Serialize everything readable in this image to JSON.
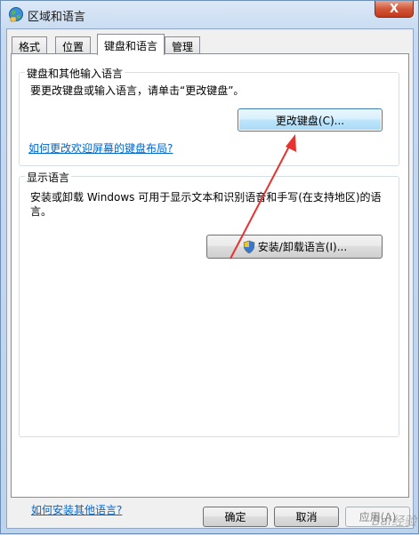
{
  "window": {
    "title": "区域和语言",
    "close_glyph": "X"
  },
  "tabs": [
    {
      "label": "格式"
    },
    {
      "label": "位置"
    },
    {
      "label": "键盘和语言"
    },
    {
      "label": "管理"
    }
  ],
  "keyboard_group": {
    "legend": "键盘和其他输入语言",
    "description": "要更改键盘或输入语言，请单击“更改键盘”。",
    "change_button": "更改键盘(C)...",
    "welcome_link": "如何更改欢迎屏幕的键盘布局?"
  },
  "display_group": {
    "legend": "显示语言",
    "description_line1": "安装或卸载 Windows 可用于显示文本和识别语音和手写(在支持地区)的语",
    "description_line2": "言。",
    "install_button": "安装/卸载语言(I)..."
  },
  "footer": {
    "other_lang_link": "如何安装其他语言?",
    "ok": "确定",
    "cancel": "取消",
    "apply": "应用(A)"
  },
  "annotation": {
    "arrow_color": "#e8322f"
  },
  "watermark": "Bai经验"
}
